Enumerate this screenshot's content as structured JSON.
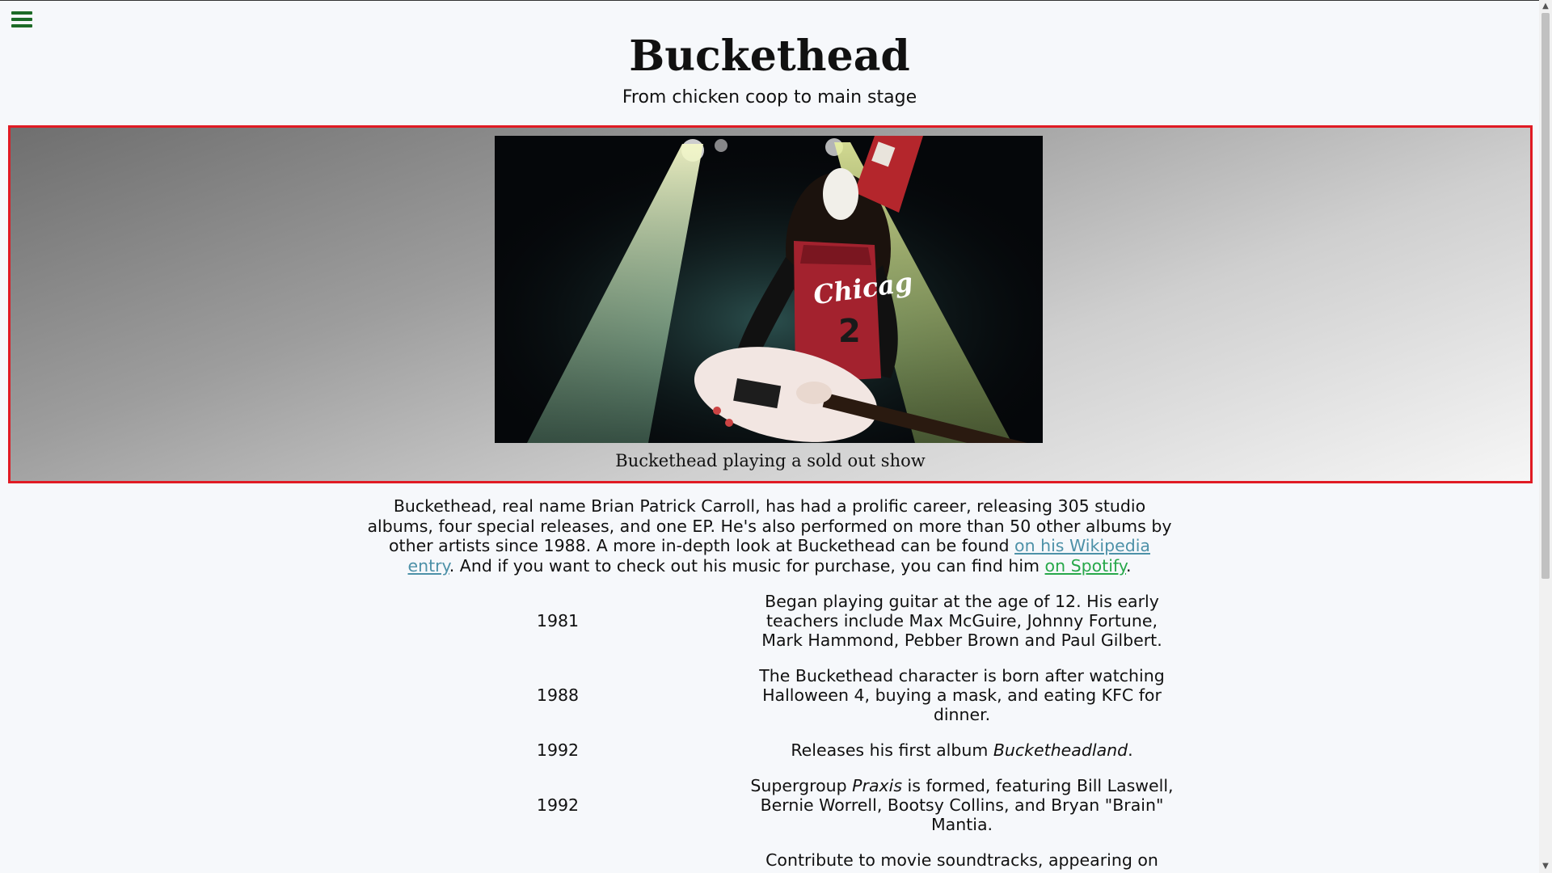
{
  "header": {
    "title": "Buckethead",
    "subtitle": "From chicken coop to main stage"
  },
  "hero": {
    "image_alt": "Buckethead on stage wearing a KFC bucket hat and Chicago jersey, playing a white guitar under stage lights",
    "caption": "Buckethead playing a sold out show",
    "border_color": "#e01b24"
  },
  "intro": {
    "text_1": "Buckethead, real name Brian Patrick Carroll, has had a prolific career, releasing 305 studio albums, four special releases, and one EP. He's also performed on more than 50 other albums by other artists since 1988. A more in-depth look at Buckethead can be found ",
    "wiki_link": "on his Wikipedia entry",
    "text_2": ". And if you want to check out his music for purchase, you can find him ",
    "spotify_link": "on Spotify",
    "text_3": "."
  },
  "timeline": [
    {
      "year": "1981",
      "description": "Began playing guitar at the age of 12. His early teachers include Max McGuire, Johnny Fortune, Mark Hammond, Pebber Brown and Paul Gilbert."
    },
    {
      "year": "1988",
      "description": "The Buckethead character is born after watching Halloween 4, buying a mask, and eating KFC for dinner."
    },
    {
      "year": "1992",
      "desc_prefix": "Releases his first album ",
      "desc_italic": "Bucketheadland",
      "desc_suffix": "."
    },
    {
      "year": "1992",
      "desc_prefix": "Supergroup ",
      "desc_italic": "Praxis",
      "desc_suffix": " is formed, featuring Bill Laswell, Bernie Worrell, Bootsy Collins, and Bryan \"Brain\" Mantia."
    },
    {
      "year": "",
      "description": "Contribute to movie soundtracks, appearing on"
    }
  ],
  "icons": {
    "menu": "hamburger-menu-icon",
    "scroll_up": "chevron-up-icon",
    "scroll_down": "chevron-down-icon"
  },
  "colors": {
    "menu_icon": "#1d6b27",
    "link_wiki": "#4d91a8",
    "link_spotify": "#27a84a",
    "background": "#f6f8fb"
  }
}
